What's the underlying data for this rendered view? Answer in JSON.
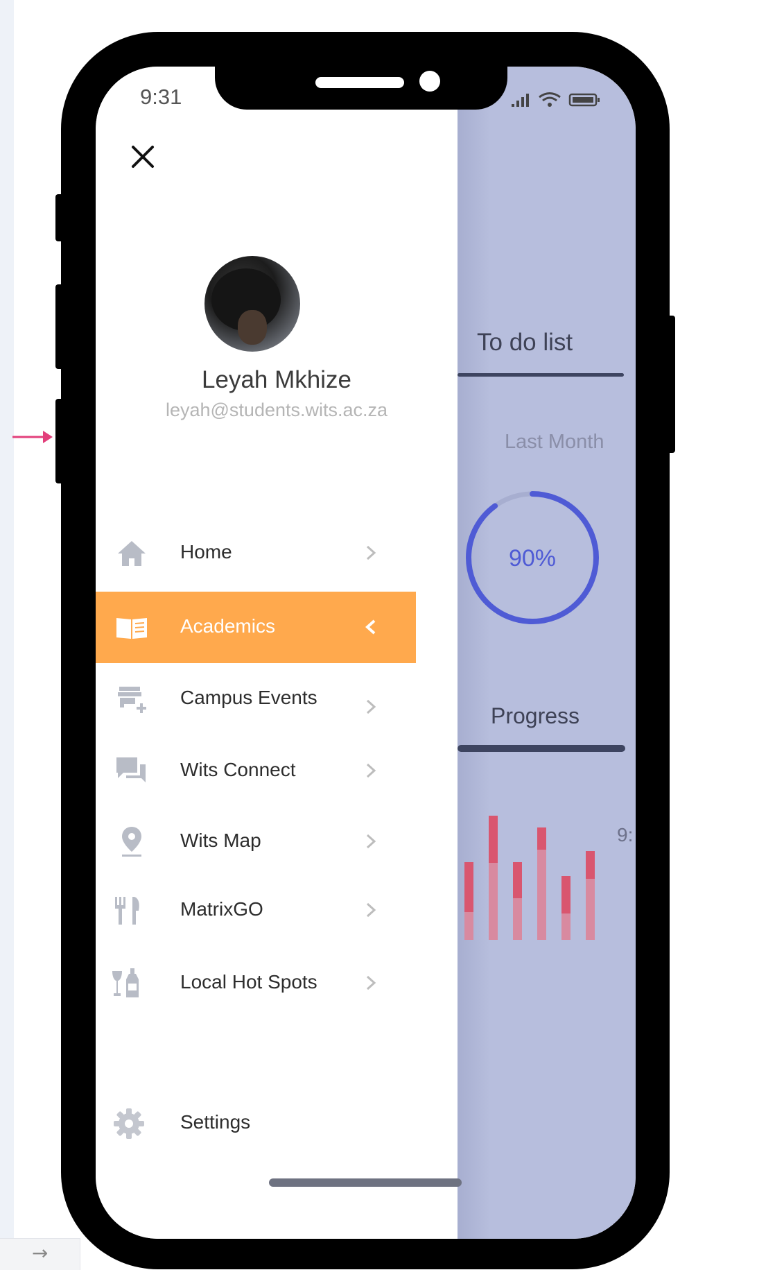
{
  "status_bar": {
    "time": "9:31"
  },
  "drawer": {
    "close_icon": "close-icon",
    "user": {
      "name": "Leyah Mkhize",
      "email": "leyah@students.wits.ac.za"
    },
    "menu": [
      {
        "label": "Home",
        "icon": "home-icon",
        "active": false
      },
      {
        "label": "Academics",
        "icon": "book-icon",
        "active": true
      },
      {
        "label": "Campus Events",
        "icon": "store-add-icon",
        "active": false
      },
      {
        "label": "Wits Connect",
        "icon": "chat-icon",
        "active": false
      },
      {
        "label": "Wits Map",
        "icon": "map-pin-icon",
        "active": false
      },
      {
        "label": "MatrixGO",
        "icon": "restaurant-icon",
        "active": false
      },
      {
        "label": "Local Hot Spots",
        "icon": "drinks-icon",
        "active": false
      }
    ],
    "settings": {
      "label": "Settings",
      "icon": "gear-icon"
    }
  },
  "background_dashboard": {
    "todo_title": "To do list",
    "period": "Last Month",
    "completion": {
      "label": "90%",
      "value": 0.9
    },
    "progress_title": "Progress",
    "card_time": "9:"
  },
  "colors": {
    "accent": "#ffa94d",
    "ring": "#4f5bd5",
    "overlay": "#b7bedd",
    "bar": "#d9566f"
  }
}
